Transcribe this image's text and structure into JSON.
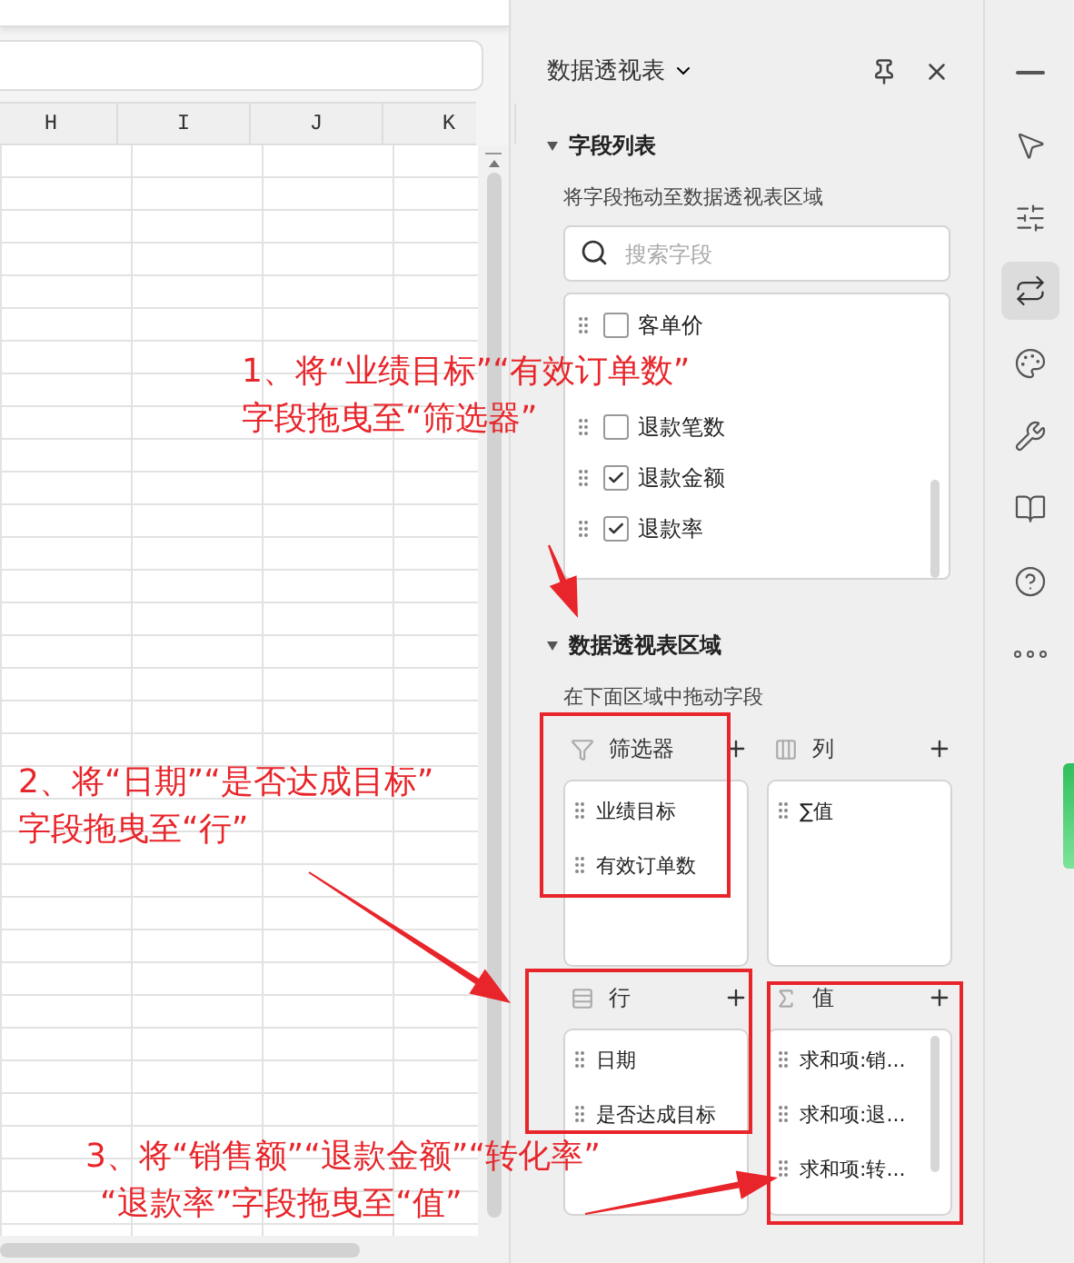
{
  "sheet": {
    "columns": [
      "H",
      "I",
      "J",
      "K"
    ]
  },
  "panel": {
    "title": "数据透视表",
    "field_section": {
      "title": "字段列表",
      "expanded": true,
      "hint": "将字段拖动至数据透视表区域",
      "search": {
        "placeholder": "搜索字段"
      },
      "fields": [
        {
          "kind": "field",
          "label": "客单价",
          "checked": false
        },
        {
          "kind": "covered"
        },
        {
          "kind": "field",
          "label": "退款笔数",
          "checked": false
        },
        {
          "kind": "field",
          "label": "退款金额",
          "checked": true
        },
        {
          "kind": "field",
          "label": "退款率",
          "checked": true
        }
      ]
    },
    "area_section": {
      "title": "数据透视表区域",
      "expanded": true,
      "hint": "在下面区域中拖动字段",
      "areas": [
        {
          "kind": "filter",
          "title": "筛选器",
          "items": [
            "业绩目标",
            "有效订单数"
          ]
        },
        {
          "kind": "columns",
          "title": "列",
          "items": [
            "∑值"
          ]
        },
        {
          "kind": "rows",
          "title": "行",
          "items": [
            "日期",
            "是否达成目标"
          ]
        },
        {
          "kind": "values",
          "title": "值",
          "items": [
            "求和项:销...",
            "求和项:退...",
            "求和项:转..."
          ]
        }
      ]
    }
  },
  "side_tools": [
    {
      "kind": "minimize",
      "selected": false
    },
    {
      "kind": "select",
      "selected": false
    },
    {
      "kind": "adjust",
      "selected": false
    },
    {
      "kind": "pivot",
      "selected": true
    },
    {
      "kind": "style",
      "selected": false
    },
    {
      "kind": "tools",
      "selected": false
    },
    {
      "kind": "book",
      "selected": false
    },
    {
      "kind": "help",
      "selected": false
    },
    {
      "kind": "more",
      "selected": false
    }
  ],
  "annotations": [
    {
      "lines": [
        "1、将“业绩目标”“有效订单数”",
        "字段拖曳至“筛选器”"
      ]
    },
    {
      "lines": [
        "2、将“日期”“是否达成目标”",
        "字段拖曳至“行”"
      ]
    },
    {
      "lines": [
        "3、将“销售额”“退款金额”“转化率”",
        "“退款率”字段拖曳至“值”"
      ]
    }
  ]
}
